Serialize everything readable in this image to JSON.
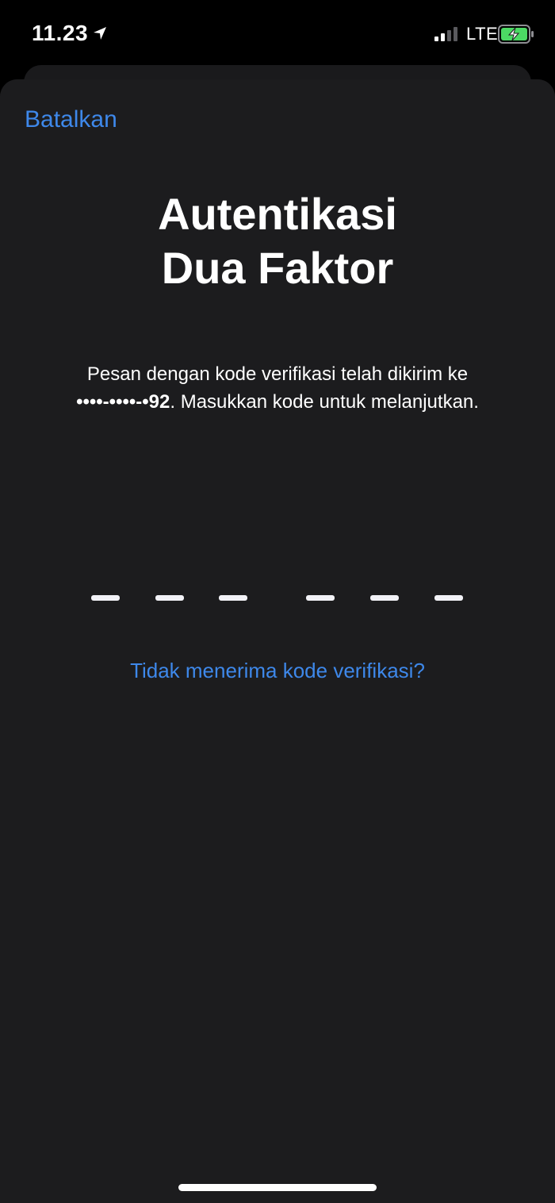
{
  "status_bar": {
    "time": "11.23",
    "network": "LTE",
    "icons": [
      "location-arrow-icon",
      "signal-strength-icon",
      "battery-charging-icon"
    ],
    "signal_bars_filled": 2,
    "signal_bars_total": 4
  },
  "nav": {
    "cancel_label": "Batalkan"
  },
  "title": {
    "line1": "Autentikasi",
    "line2": "Dua Faktor"
  },
  "message": {
    "text_before": "Pesan dengan kode verifikasi telah dikirim ke",
    "masked_number": "••••-••••-•92",
    "text_after": ". Masukkan kode untuk melanjutkan."
  },
  "code_input": {
    "digits": 6,
    "value": ""
  },
  "resend_link": "Tidak menerima kode verifikasi?",
  "colors": {
    "accent": "#3e88ea",
    "sheet_background": "#1c1c1e",
    "status_bar_background": "#000000",
    "battery_fill": "#4cd964"
  }
}
